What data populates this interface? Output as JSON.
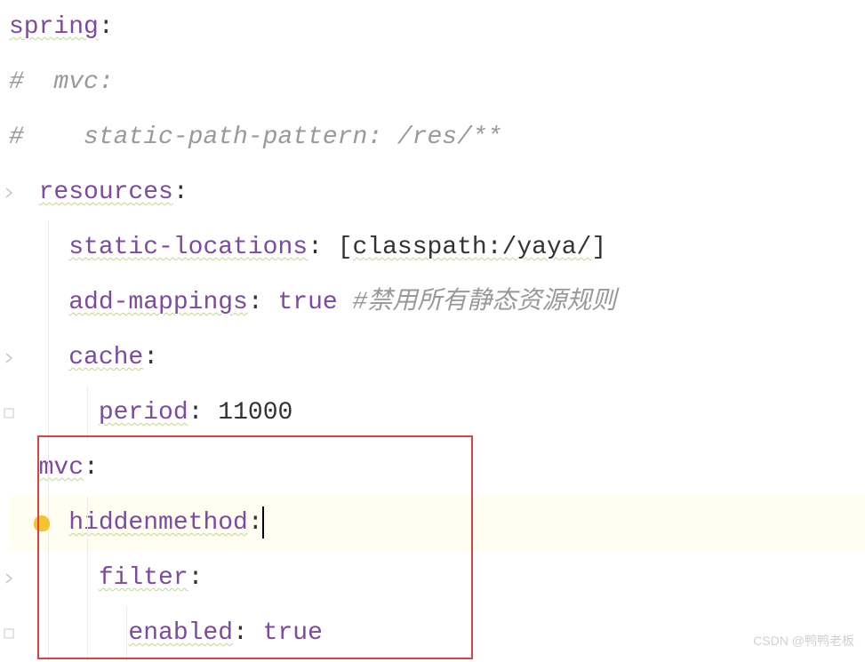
{
  "lines": {
    "l1": {
      "key": "spring",
      "colon": ":"
    },
    "l2": {
      "comment_prefix": "#",
      "comment_body": "  mvc:"
    },
    "l3": {
      "comment_prefix": "#",
      "comment_body": "    static-path-pattern: /res/**"
    },
    "l4": {
      "key": "resources",
      "colon": ":"
    },
    "l5": {
      "key": "static-locations",
      "colon": ":",
      "bracket_open": "[",
      "value": "classpath:/yaya/",
      "bracket_close": "]"
    },
    "l6": {
      "key": "add-mappings",
      "colon": ":",
      "value": "true",
      "comment": "#禁用所有静态资源规则"
    },
    "l7": {
      "key": "cache",
      "colon": ":"
    },
    "l8": {
      "key": "period",
      "colon": ":",
      "value": "11000"
    },
    "l9": {
      "key": "mvc",
      "colon": ":"
    },
    "l10": {
      "key": "hiddenmethod",
      "colon": ":"
    },
    "l11": {
      "key": "filter",
      "colon": ":"
    },
    "l12": {
      "key": "enabled",
      "colon": ":",
      "value": "true"
    }
  },
  "watermark": "CSDN @鸭鸭老板"
}
